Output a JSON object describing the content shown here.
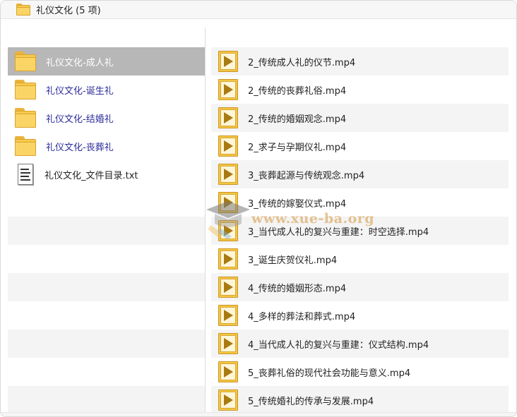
{
  "window": {
    "title": "礼仪文化 (5 项)"
  },
  "left_pane": {
    "items": [
      {
        "label": "礼仪文化-成人礼",
        "type": "folder",
        "selected": true
      },
      {
        "label": "礼仪文化-诞生礼",
        "type": "folder",
        "selected": false
      },
      {
        "label": "礼仪文化-结婚礼",
        "type": "folder",
        "selected": false
      },
      {
        "label": "礼仪文化-丧葬礼",
        "type": "folder",
        "selected": false
      },
      {
        "label": "礼仪文化_文件目录.txt",
        "type": "text-file",
        "selected": false
      }
    ]
  },
  "right_pane": {
    "items": [
      {
        "label": "2_传统成人礼的仪节.mp4"
      },
      {
        "label": "2_传统的丧葬礼俗.mp4"
      },
      {
        "label": "2_传统的婚姻观念.mp4"
      },
      {
        "label": "2_求子与孕期仪礼.mp4"
      },
      {
        "label": "3_丧葬起源与传统观念.mp4"
      },
      {
        "label": "3_传统的嫁娶仪式.mp4"
      },
      {
        "label": "3_当代成人礼的复兴与重建：时空选择.mp4"
      },
      {
        "label": "3_诞生庆贺仪礼.mp4"
      },
      {
        "label": "4_传统的婚姻形态.mp4"
      },
      {
        "label": "4_多样的葬法和葬式.mp4"
      },
      {
        "label": "4_当代成人礼的复兴与重建：仪式结构.mp4"
      },
      {
        "label": "5_丧葬礼俗的现代社会功能与意义.mp4"
      },
      {
        "label": "5_传统婚礼的传承与发展.mp4"
      }
    ]
  },
  "watermark": {
    "text": "www.xue-ba.org"
  },
  "colors": {
    "selected_row": "#b7b7b7",
    "folder_label": "#2c2c9c",
    "folder_yellow": "#f8c94e",
    "video_icon": "#f6c640"
  }
}
